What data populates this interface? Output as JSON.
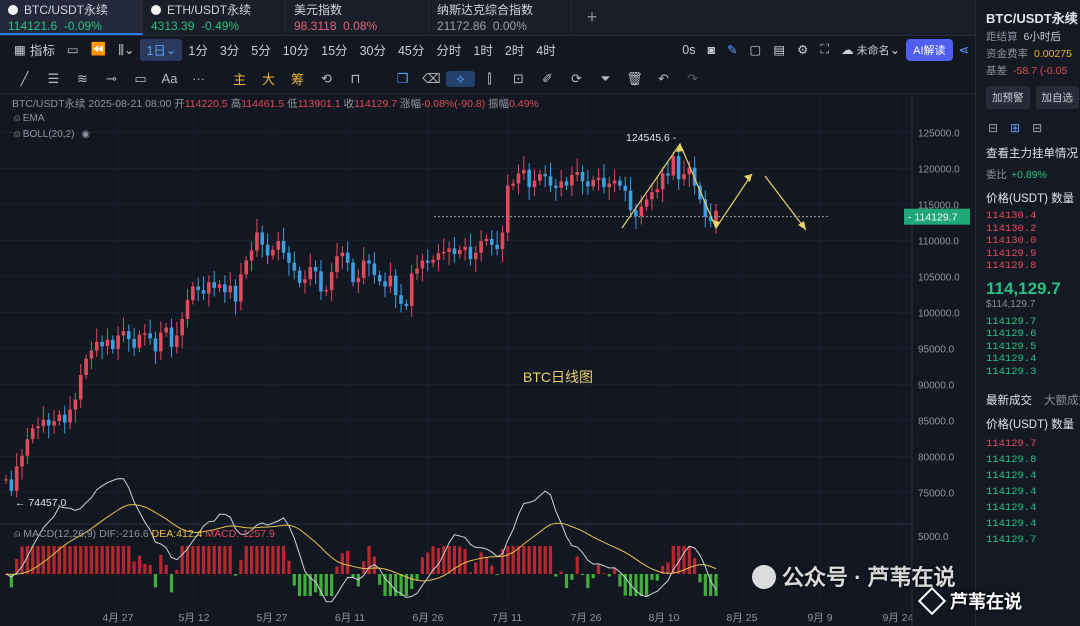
{
  "tabs": [
    {
      "name": "BTC/USDT永续",
      "price": "114121.6",
      "change": "-0.09%",
      "price_color": "up",
      "change_color": "up"
    },
    {
      "name": "ETH/USDT永续",
      "price": "4313.39",
      "change": "-0.49%",
      "price_color": "up",
      "change_color": "up"
    },
    {
      "name": "美元指数",
      "price": "98.3118",
      "change": "0.08%",
      "price_color": "pink",
      "change_color": "pink"
    },
    {
      "name": "纳斯达克综合指数",
      "price": "21172.86",
      "change": "0.00%",
      "price_color": "muted",
      "change_color": "muted"
    }
  ],
  "toolbar": {
    "indicator": "指标",
    "interval_selected": "1日",
    "intervals": [
      "1分",
      "3分",
      "5分",
      "10分",
      "15分",
      "30分",
      "45分",
      "分时",
      "1时",
      "2时",
      "4时"
    ],
    "countdown": "0s",
    "layout_name": "未命名",
    "ai_button": "AI解读"
  },
  "drawbar": {
    "text_tool": "Aa",
    "more": "···",
    "overlays": [
      "主",
      "大",
      "筹"
    ]
  },
  "ohlc": {
    "symbol": "BTC/USDT永续",
    "date": "2025-08-21 08:00",
    "open_label": "开",
    "open": "114220.5",
    "high_label": "高",
    "high": "114461.5",
    "low_label": "低",
    "low": "113901.1",
    "close_label": "收",
    "close": "114129.7",
    "change_label": "涨幅",
    "change": "-0.08%(-90.8)",
    "amp_label": "振幅",
    "amp": "0.49%"
  },
  "indicators": {
    "ema": "EMA",
    "boll": "BOLL(20,2)"
  },
  "macd": {
    "name": "MACD(12,26,9)",
    "dif": "DIF:-216.6",
    "dea": "DEA:412.4",
    "macd": "MACD:-1257.9"
  },
  "chart_data": {
    "type": "candlestick",
    "title": "BTC日线图",
    "y_ticks": [
      "125000.0",
      "120000.0",
      "115000.0",
      "110000.0",
      "105000.0",
      "100000.0",
      "95000.0",
      "90000.0",
      "85000.0",
      "80000.0",
      "75000.0"
    ],
    "macd_tick": "5000.0",
    "x_ticks": [
      "4月 27",
      "5月 12",
      "5月 27",
      "6月 11",
      "6月 26",
      "7月 11",
      "7月 26",
      "8月 10",
      "8月 25",
      "9月 9",
      "9月 24"
    ],
    "current_price": "114129.7",
    "high_label": "124545.6",
    "low_label": "74457.0",
    "ylim": [
      72000,
      127000
    ],
    "closes": [
      76800,
      75200,
      78600,
      80100,
      82400,
      83900,
      84200,
      85100,
      84300,
      84900,
      85800,
      84700,
      86500,
      87900,
      91300,
      93600,
      94700,
      95900,
      95300,
      96200,
      94900,
      96800,
      97400,
      96300,
      95100,
      96900,
      97100,
      96400,
      94600,
      97200,
      97900,
      95200,
      96800,
      99100,
      101700,
      103600,
      103100,
      102600,
      104200,
      103400,
      103900,
      102800,
      103700,
      101500,
      105300,
      107200,
      108600,
      111100,
      109400,
      107900,
      108700,
      109900,
      108300,
      106900,
      105800,
      104100,
      104600,
      106300,
      105700,
      102900,
      103100,
      105600,
      107800,
      108300,
      106900,
      104200,
      104800,
      107200,
      106800,
      105200,
      104300,
      103600,
      105100,
      102400,
      101200,
      100900,
      105400,
      106100,
      107200,
      106900,
      107300,
      108200,
      108400,
      108900,
      108100,
      108700,
      109100,
      107400,
      108300,
      109900,
      110200,
      109400,
      108800,
      111100,
      117600,
      117900,
      119300,
      119800,
      117400,
      118300,
      119200,
      118900,
      117600,
      117300,
      118200,
      117600,
      119100,
      119500,
      118200,
      117500,
      118400,
      118700,
      117400,
      117900,
      118300,
      117600,
      116900,
      114200,
      113400,
      114700,
      115700,
      116700,
      117100,
      119300,
      119000,
      121700,
      118500,
      119200,
      120100,
      117600,
      115700,
      113300,
      112700,
      114129.7
    ],
    "macd_hist_note": "green/red histogram with DIF and DEA lines"
  },
  "side": {
    "title": "BTC/USDT永续",
    "settle_label": "距结算",
    "settle": "6小时后",
    "funding_label": "资金费率",
    "funding": "0.00275",
    "basis_label": "基差",
    "basis": "-58.7 (-0.05",
    "btn_alert": "加预警",
    "btn_watch": "加自选",
    "orderbook_section": "查看主力挂单情况",
    "ratio_label": "委比",
    "ratio": "+0.89%",
    "col_price": "价格(USDT)",
    "col_qty": "数量",
    "asks": [
      "114130.4",
      "114130.2",
      "114130.0",
      "114129.9",
      "114129.8"
    ],
    "last": "114,129.7",
    "last_sub": "$114,129.7",
    "bids": [
      "114129.7",
      "114129.6",
      "114129.5",
      "114129.4",
      "114129.3"
    ],
    "trades_tab": "最新成交",
    "bigtrades_tab": "大额成交",
    "trades": [
      {
        "price": "114129.7",
        "side": "ask"
      },
      {
        "price": "114129.8",
        "side": "bid"
      },
      {
        "price": "114129.4",
        "side": "bid"
      },
      {
        "price": "114129.4",
        "side": "bid"
      },
      {
        "price": "114129.4",
        "side": "bid"
      },
      {
        "price": "114129.4",
        "side": "bid"
      },
      {
        "price": "114129.7",
        "side": "bid"
      }
    ]
  },
  "watermark": {
    "wechat": "公众号 · 芦苇在说",
    "brand": "芦苇在说"
  }
}
